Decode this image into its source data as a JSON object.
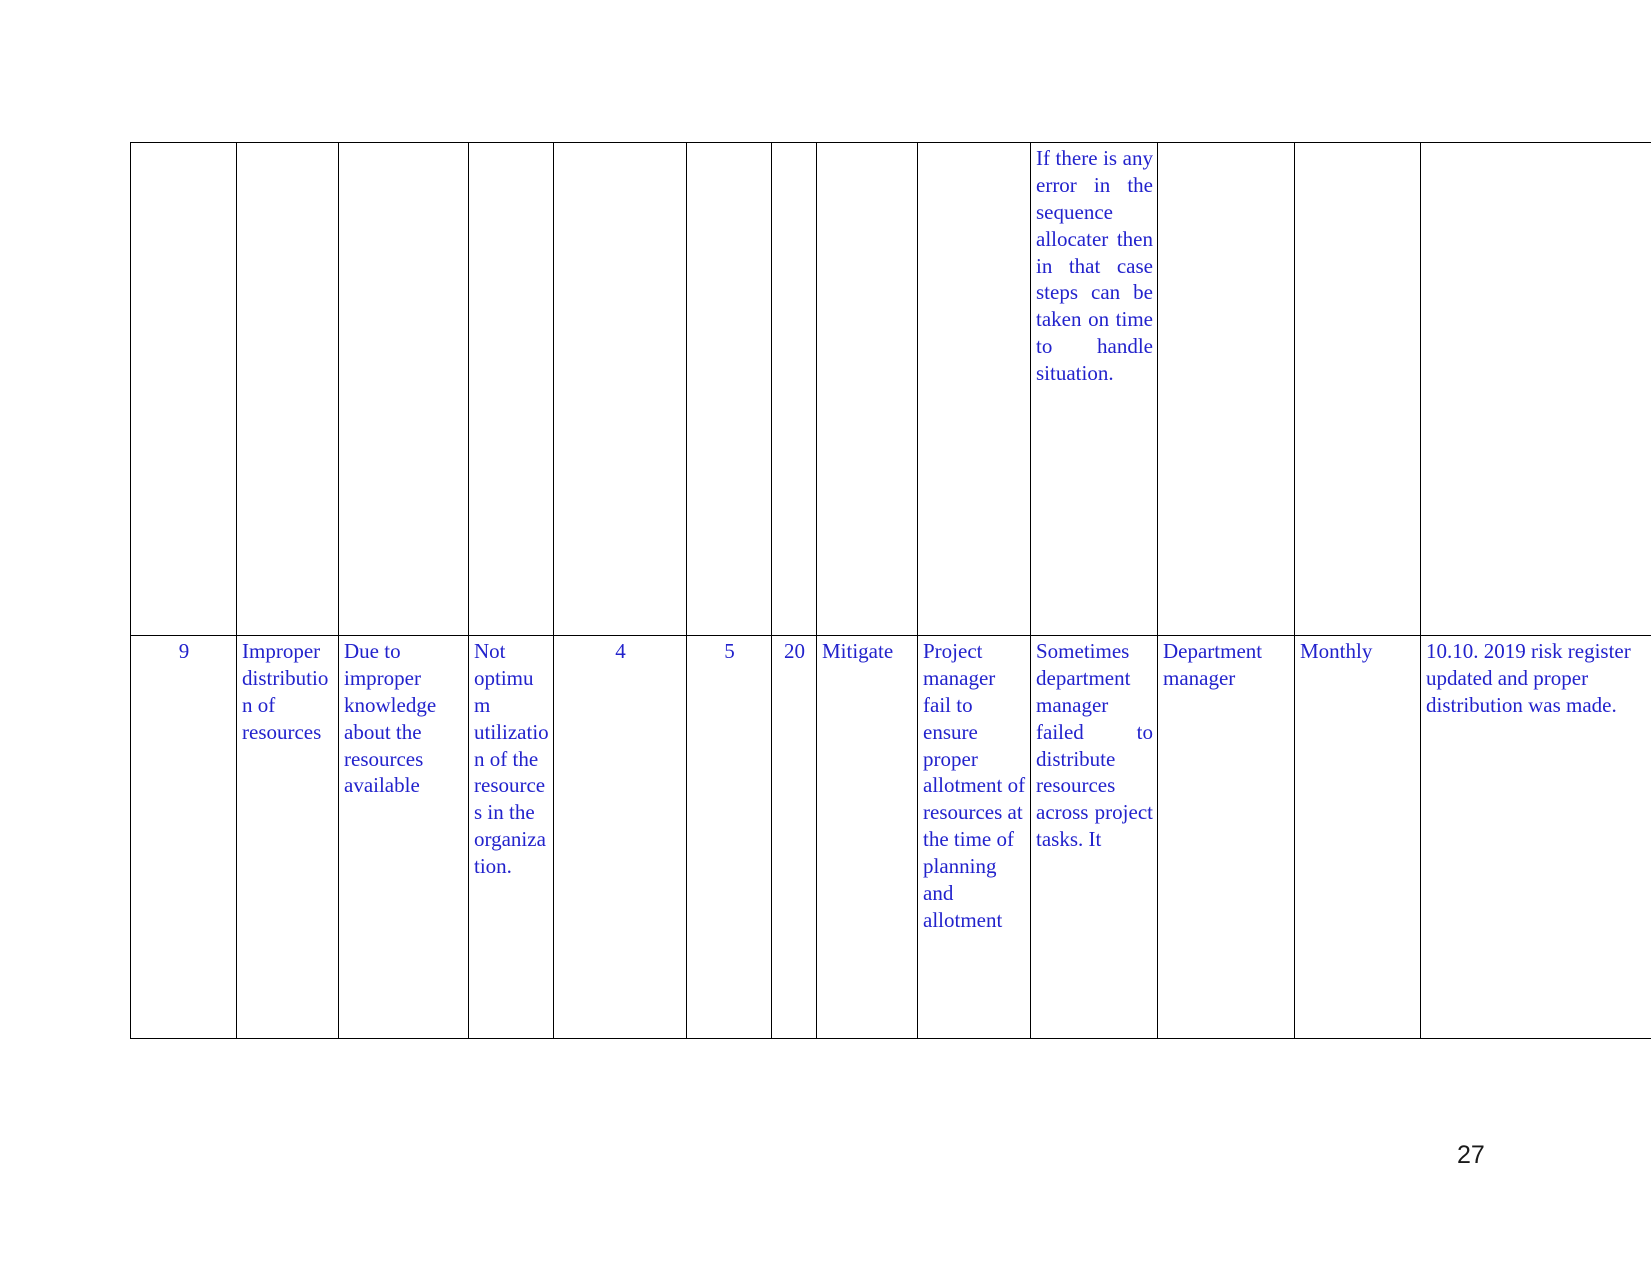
{
  "document": {
    "page_number": "27",
    "text_color": "#2222cc",
    "border_color": "#000000",
    "page_number_color": "#1a1a1a"
  },
  "table": {
    "name": "risk-register-table",
    "column_count": 13,
    "rows": [
      {
        "id": "row-continued",
        "cells": [
          {
            "col": 1,
            "name": "serial-number",
            "value": ""
          },
          {
            "col": 2,
            "name": "risk-name",
            "value": ""
          },
          {
            "col": 3,
            "name": "risk-cause",
            "value": ""
          },
          {
            "col": 4,
            "name": "risk-effect",
            "value": ""
          },
          {
            "col": 5,
            "name": "probability",
            "value": ""
          },
          {
            "col": 6,
            "name": "impact",
            "value": ""
          },
          {
            "col": 7,
            "name": "risk-score",
            "value": ""
          },
          {
            "col": 8,
            "name": "response-strategy",
            "value": ""
          },
          {
            "col": 9,
            "name": "trigger",
            "value": ""
          },
          {
            "col": 10,
            "name": "response-action",
            "value": "If there is any error in the sequence allocater then in that case steps can be taken on time to handle situation."
          },
          {
            "col": 11,
            "name": "risk-owner",
            "value": ""
          },
          {
            "col": 12,
            "name": "review-frequency",
            "value": ""
          },
          {
            "col": 13,
            "name": "status-update",
            "value": ""
          }
        ]
      },
      {
        "id": "row-9",
        "cells": [
          {
            "col": 1,
            "name": "serial-number",
            "value": "9"
          },
          {
            "col": 2,
            "name": "risk-name",
            "value": "Improper distribution of resources"
          },
          {
            "col": 3,
            "name": "risk-cause",
            "value": "Due to improper knowledge about the resources available"
          },
          {
            "col": 4,
            "name": "risk-effect",
            "value": "Not optimum utilization of the resources in the organization."
          },
          {
            "col": 5,
            "name": "probability",
            "value": "4"
          },
          {
            "col": 6,
            "name": "impact",
            "value": "5"
          },
          {
            "col": 7,
            "name": "risk-score",
            "value": "20"
          },
          {
            "col": 8,
            "name": "response-strategy",
            "value": "Mitigate"
          },
          {
            "col": 9,
            "name": "trigger",
            "value": "Project manager fail to ensure proper allotment of resources at the time of planning and allotment"
          },
          {
            "col": 10,
            "name": "response-action",
            "value": "Sometimes department manager failed to distribute resources across project tasks. It"
          },
          {
            "col": 11,
            "name": "risk-owner",
            "value": "Department manager"
          },
          {
            "col": 12,
            "name": "review-frequency",
            "value": "Monthly"
          },
          {
            "col": 13,
            "name": "status-update",
            "value": "10.10. 2019 risk register updated and proper distribution was made."
          }
        ]
      }
    ]
  }
}
